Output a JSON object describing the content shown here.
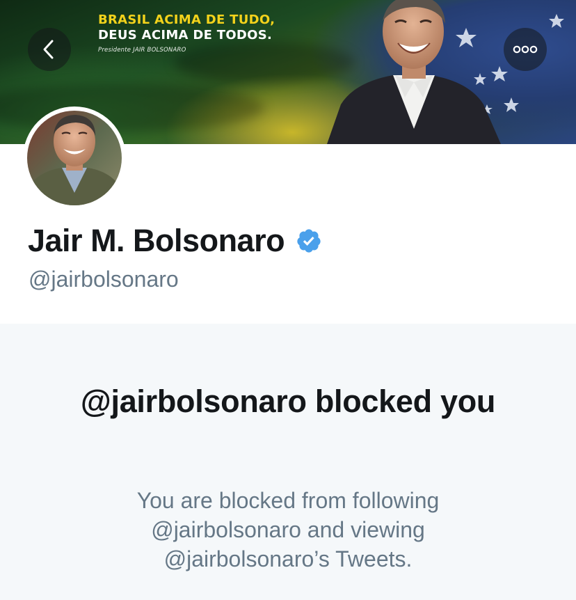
{
  "banner": {
    "headline_line1": "BRASIL ACIMA DE TUDO,",
    "headline_line2": "DEUS ACIMA DE TODOS.",
    "caption": "Presidente JAIR BOLSONARO"
  },
  "nav": {
    "back_icon": "chevron-left-icon",
    "more_icon": "more-horizontal-icon"
  },
  "profile": {
    "display_name": "Jair M. Bolsonaro",
    "handle": "@jairbolsonaro",
    "verified": true,
    "verified_color": "#4aa0eb"
  },
  "blocked": {
    "title": "@jairbolsonaro blocked you",
    "body": "You are blocked from following @jairbolsonaro and viewing @jairbolsonaro’s Tweets."
  },
  "colors": {
    "primary_text": "#14171a",
    "secondary_text": "#657786",
    "panel_bg": "#f5f8fa",
    "banner_yellow": "#f3d21b"
  }
}
